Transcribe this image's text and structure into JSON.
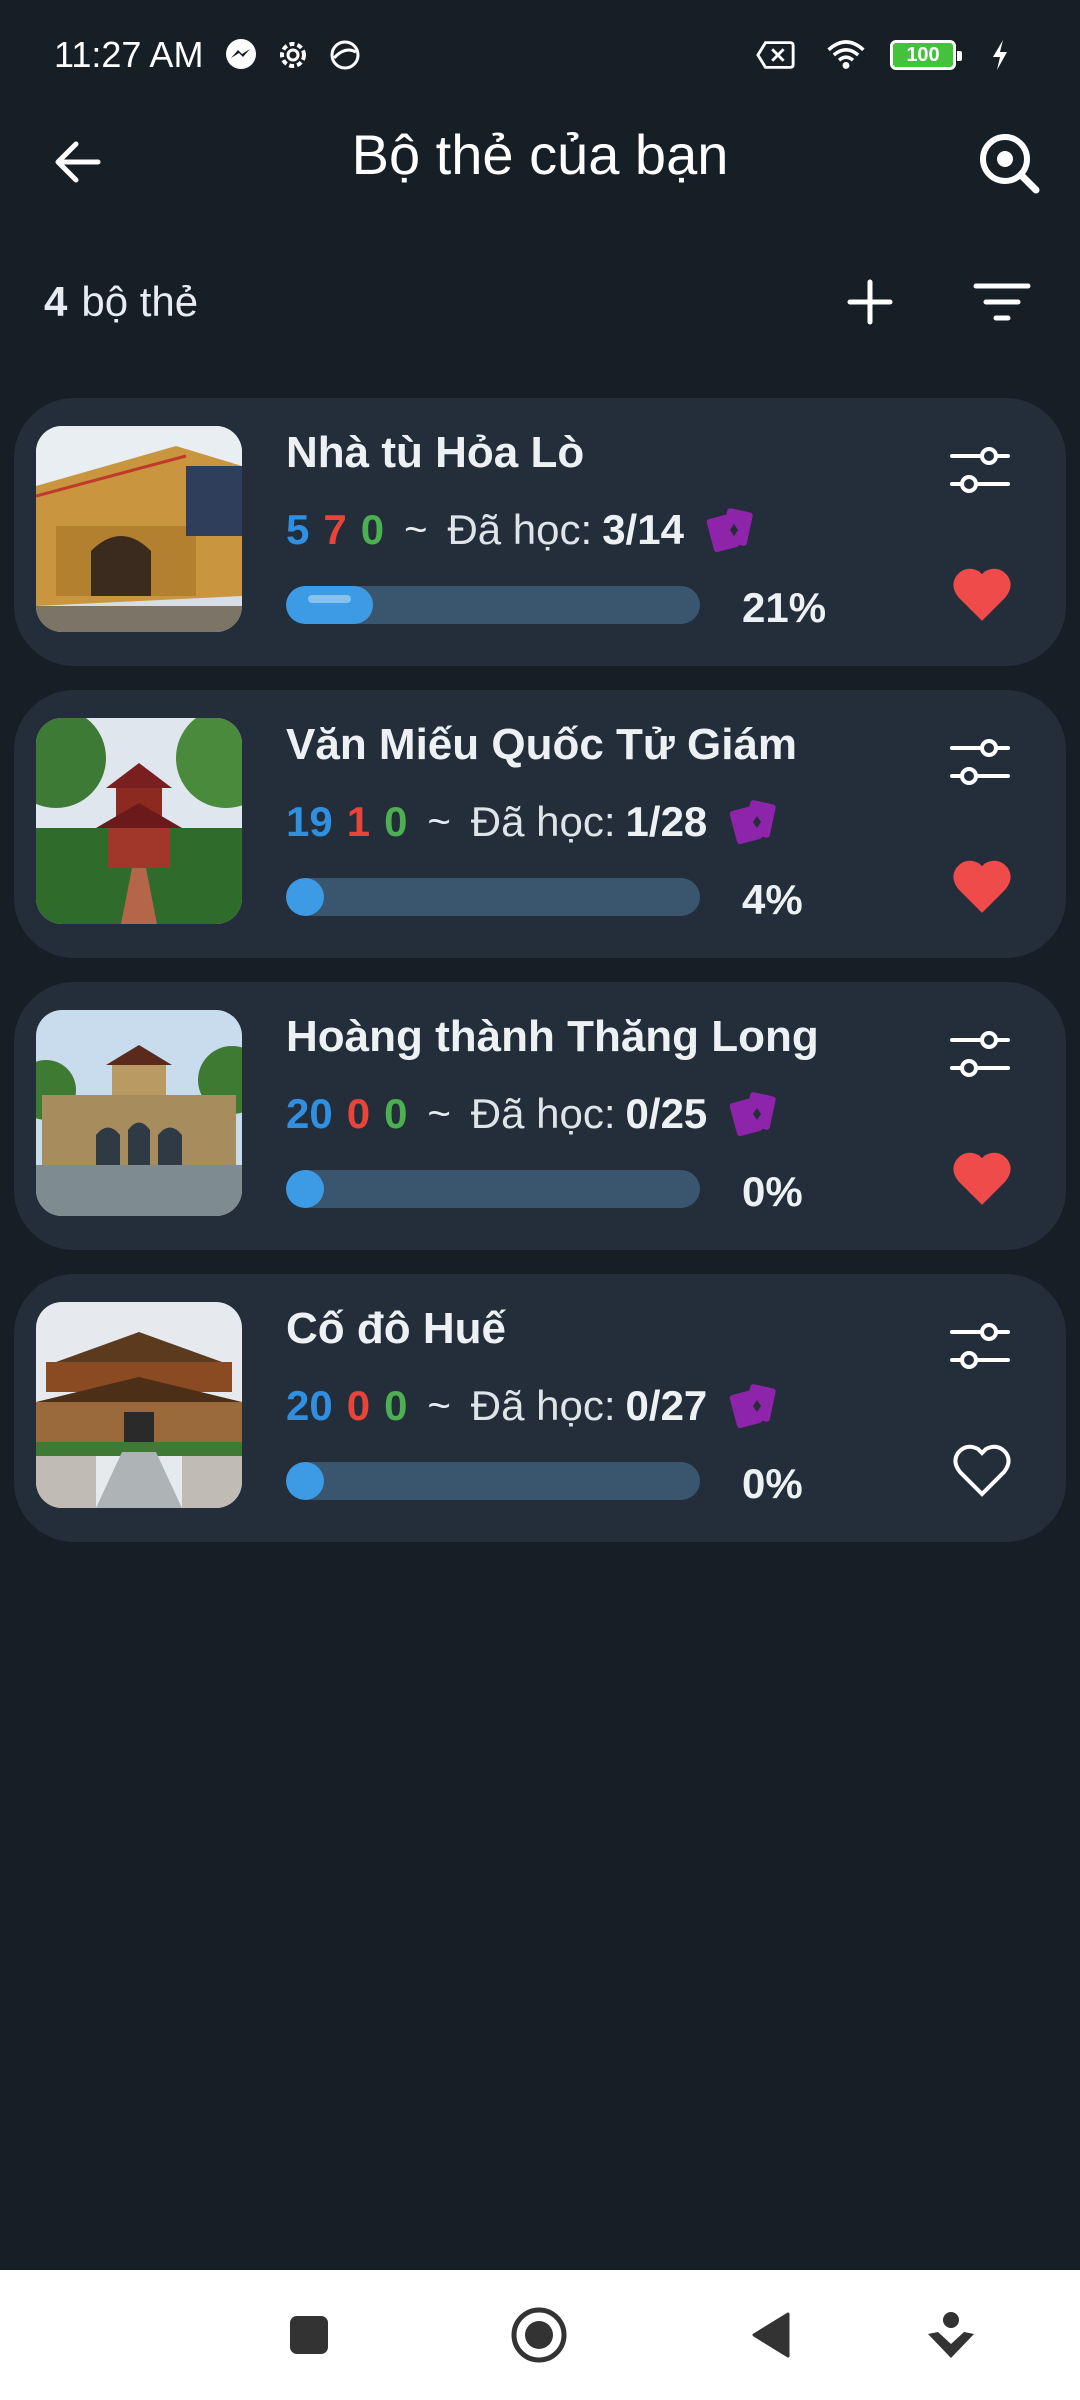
{
  "status_bar": {
    "time": "11:27 AM",
    "battery": "100",
    "icons": [
      "messenger-icon",
      "settings-gear-icon",
      "vpn-icon",
      "no-sim-icon",
      "wifi-icon",
      "battery-icon",
      "charging-icon"
    ]
  },
  "app_bar": {
    "title": "Bộ thẻ của bạn",
    "back_icon": "arrow-left-icon",
    "search_icon": "search-icon"
  },
  "toolbar": {
    "count": "4",
    "count_label": "bộ thẻ",
    "add_icon": "plus-icon",
    "filter_icon": "filter-icon"
  },
  "decks": [
    {
      "name": "Nhà tù Hỏa Lò",
      "new": "5",
      "learning": "7",
      "review": "0",
      "tilde": "~",
      "learned_label": "Đã học:",
      "learned": "3/14",
      "progress": 0.21,
      "percent": "21%",
      "favorite": true
    },
    {
      "name": "Văn Miếu Quốc Tử Giám",
      "new": "19",
      "learning": "1",
      "review": "0",
      "tilde": "~",
      "learned_label": "Đã học:",
      "learned": "1/28",
      "progress": 0.04,
      "percent": "4%",
      "favorite": true
    },
    {
      "name": "Hoàng thành Thăng Long",
      "new": "20",
      "learning": "0",
      "review": "0",
      "tilde": "~",
      "learned_label": "Đã học:",
      "learned": "0/25",
      "progress": 0.0,
      "percent": "0%",
      "favorite": true
    },
    {
      "name": "Cố đô Huế",
      "new": "20",
      "learning": "0",
      "review": "0",
      "tilde": "~",
      "learned_label": "Đã học:",
      "learned": "0/27",
      "progress": 0.0,
      "percent": "0%",
      "favorite": false
    }
  ],
  "colors": {
    "background": "#161e26",
    "card": "#232e3a",
    "new_count": "#2f8fe0",
    "learning_count": "#e8443a",
    "review_count": "#4caf50",
    "progress_fill": "#3d9be6",
    "heart": "#f04b4b",
    "deck_icon": "#8e24aa"
  },
  "nav_bar": {
    "icons": [
      "recents-square-icon",
      "home-circle-icon",
      "back-triangle-icon",
      "assistant-icon"
    ]
  }
}
